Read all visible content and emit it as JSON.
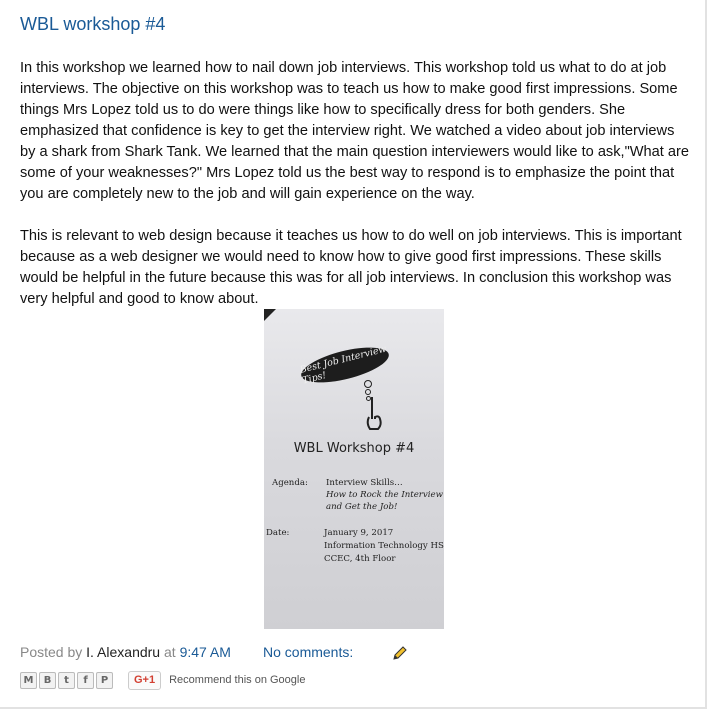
{
  "post": {
    "title": "WBL workshop #4",
    "paragraphs": [
      "In this workshop we learned how to nail down job interviews. This workshop told us what to do at job interviews. The objective on this workshop was to teach us how to make good first impressions. Some things Mrs Lopez told us to do were things like how to specifically dress for both genders. She emphasized that confidence is key to get the interview right. We watched a video about job interviews by a shark from Shark Tank. We learned that the main question interviewers would like to ask,\"What are some of your weaknesses?\" Mrs Lopez told us the best way to respond is to emphasize the point that you are completely new to the job and will gain experience on the way.",
      "This is relevant to web design because it teaches us how to do well on job interviews. This is important because as a web designer we would need to know how to give good first impressions. These skills would be helpful in the future because this was for all job interviews. In conclusion this workshop was very helpful and good to know about."
    ]
  },
  "photo": {
    "bubble_text": "Best Job Interview Tips!",
    "doc_title": "WBL Workshop #4",
    "agenda_label": "Agenda:",
    "agenda_line1": "Interview Skills…",
    "agenda_line2": "How to Rock the Interview",
    "agenda_line3": "and Get the Job!",
    "date_label": "Date:",
    "date_line1": "January  9, 2017",
    "date_line2": "Information Technology HS",
    "date_line3": "CCEC, 4th Floor"
  },
  "footer": {
    "posted_by": "Posted by",
    "author": "I. Alexandru",
    "at": "at",
    "time": "9:47 AM",
    "comments": "No comments:",
    "edit_icon": "pencil-icon"
  },
  "share": {
    "buttons": [
      {
        "icon": "email-icon",
        "glyph": "M"
      },
      {
        "icon": "blogger-icon",
        "glyph": "B"
      },
      {
        "icon": "twitter-icon",
        "glyph": "t"
      },
      {
        "icon": "facebook-icon",
        "glyph": "f"
      },
      {
        "icon": "pinterest-icon",
        "glyph": "P"
      }
    ],
    "gplus_label": "G+1",
    "recommend": "Recommend this on Google"
  },
  "colors": {
    "link": "#1a5a96",
    "text": "#111111",
    "muted": "#888888"
  }
}
